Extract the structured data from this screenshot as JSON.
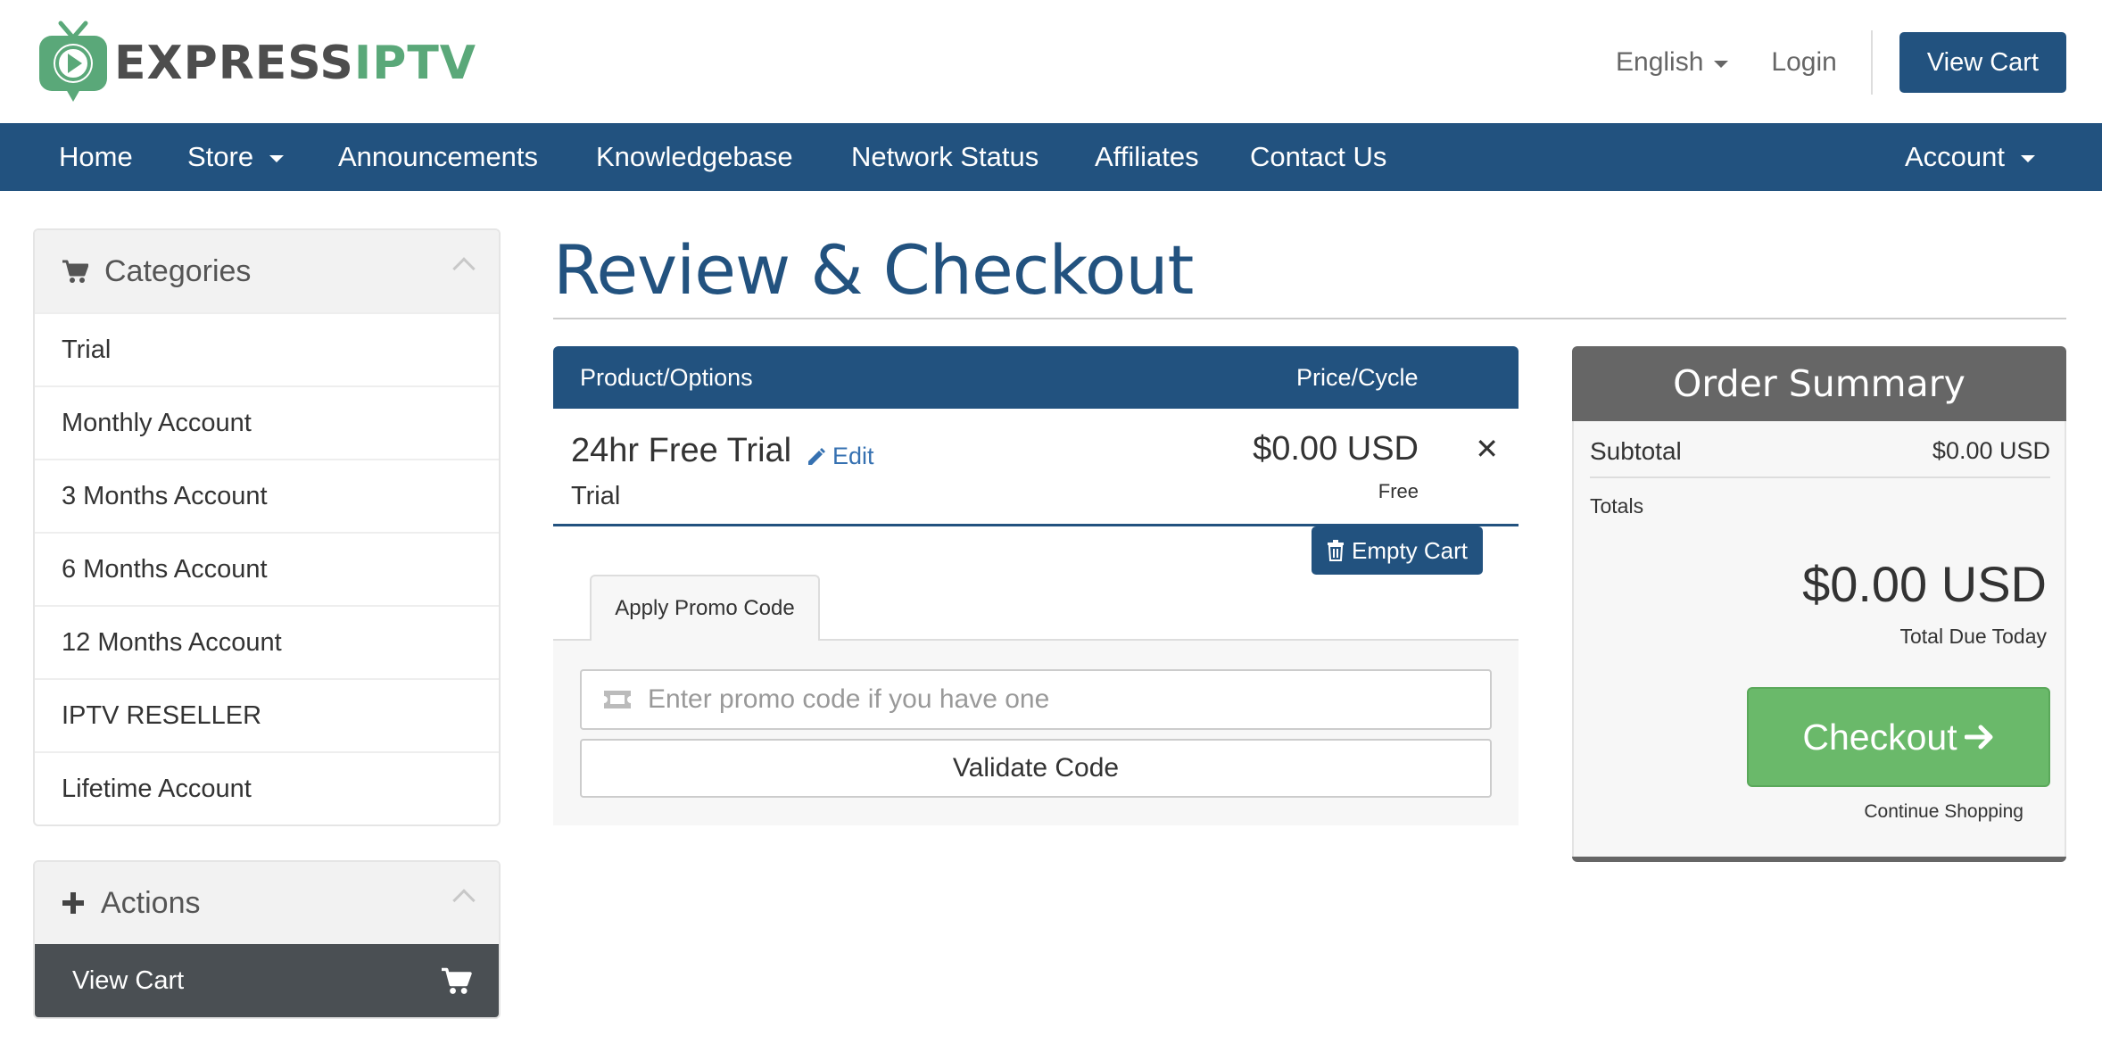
{
  "logo": {
    "part1": "EXPRESS",
    "part2": "IPTV"
  },
  "header": {
    "language": "English",
    "login": "Login",
    "view_cart": "View Cart"
  },
  "nav": {
    "items": [
      {
        "label": "Home"
      },
      {
        "label": "Store"
      },
      {
        "label": "Announcements"
      },
      {
        "label": "Knowledgebase"
      },
      {
        "label": "Network Status"
      },
      {
        "label": "Affiliates"
      },
      {
        "label": "Contact Us"
      }
    ],
    "account": "Account"
  },
  "sidebar": {
    "categories_title": "Categories",
    "categories": [
      "Trial",
      "Monthly Account",
      "3 Months Account",
      "6 Months Account",
      "12 Months Account",
      "IPTV RESELLER",
      "Lifetime Account"
    ],
    "actions_title": "Actions",
    "actions": [
      {
        "label": "View Cart"
      }
    ]
  },
  "main": {
    "title": "Review & Checkout",
    "table": {
      "col_product": "Product/Options",
      "col_price": "Price/Cycle",
      "rows": [
        {
          "name": "24hr Free Trial",
          "edit": "Edit",
          "group": "Trial",
          "price": "$0.00 USD",
          "cycle": "Free"
        }
      ]
    },
    "empty_cart": "Empty Cart",
    "promo": {
      "tab": "Apply Promo Code",
      "placeholder": "Enter promo code if you have one",
      "validate": "Validate Code"
    }
  },
  "summary": {
    "title": "Order Summary",
    "subtotal_label": "Subtotal",
    "subtotal_value": "$0.00 USD",
    "totals_label": "Totals",
    "total_amount": "$0.00 USD",
    "total_due_label": "Total Due Today",
    "checkout": "Checkout",
    "continue": "Continue Shopping"
  },
  "colors": {
    "brand_blue": "#22527f",
    "logo_green": "#5aa879",
    "checkout_green": "#6ab96a",
    "summary_gray": "#666666"
  },
  "icons": {
    "cart": "shopping-cart-icon",
    "plus": "plus-icon",
    "edit": "pencil-icon",
    "remove": "close-icon",
    "trash": "trash-icon",
    "ticket": "ticket-icon",
    "arrow": "arrow-right-icon"
  }
}
